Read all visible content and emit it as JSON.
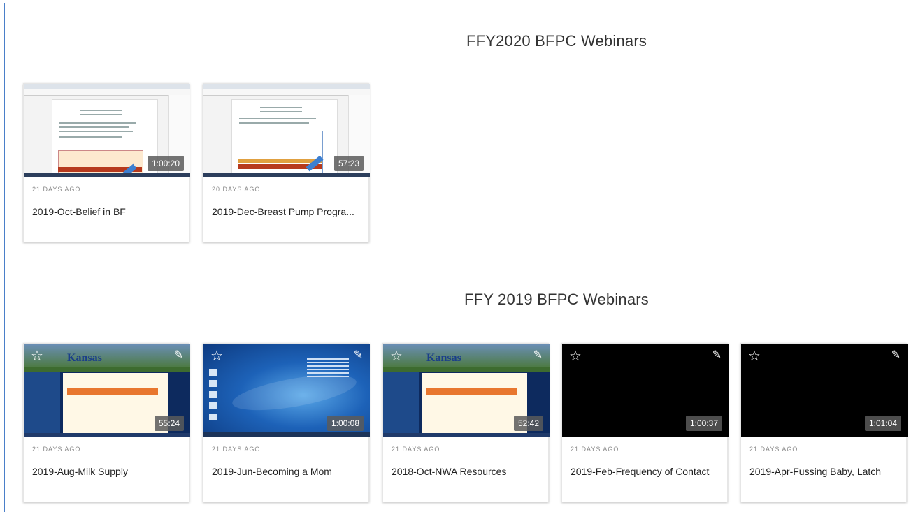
{
  "sections": [
    {
      "title": "FFY2020 BFPC Webinars"
    },
    {
      "title": "FFY 2019 BFPC Webinars"
    }
  ],
  "videos_2020": [
    {
      "age": "21 DAYS AGO",
      "title": "2019-Oct-Belief in BF",
      "duration": "1:00:20"
    },
    {
      "age": "20 DAYS AGO",
      "title": "2019-Dec-Breast Pump Progra...",
      "duration": "57:23"
    }
  ],
  "videos_2019": [
    {
      "age": "21 DAYS AGO",
      "title": "2019-Aug-Milk Supply",
      "duration": "55:24",
      "thumb_logo": "Kansas"
    },
    {
      "age": "21 DAYS AGO",
      "title": "2019-Jun-Becoming a Mom",
      "duration": "1:00:08"
    },
    {
      "age": "21 DAYS AGO",
      "title": "2018-Oct-NWA Resources",
      "duration": "52:42",
      "thumb_logo": "Kansas"
    },
    {
      "age": "21 DAYS AGO",
      "title": "2019-Feb-Frequency of Contact",
      "duration": "1:00:37"
    },
    {
      "age": "21 DAYS AGO",
      "title": "2019-Apr-Fussing Baby, Latch",
      "duration": "1:01:04"
    }
  ],
  "icons": {
    "star": "star-outline-icon",
    "edit": "pencil-icon",
    "star_glyph": "☆",
    "edit_glyph": "✎"
  },
  "colors": {
    "frame": "#4a7fc9",
    "duration_bg": "#5a5a5a"
  }
}
